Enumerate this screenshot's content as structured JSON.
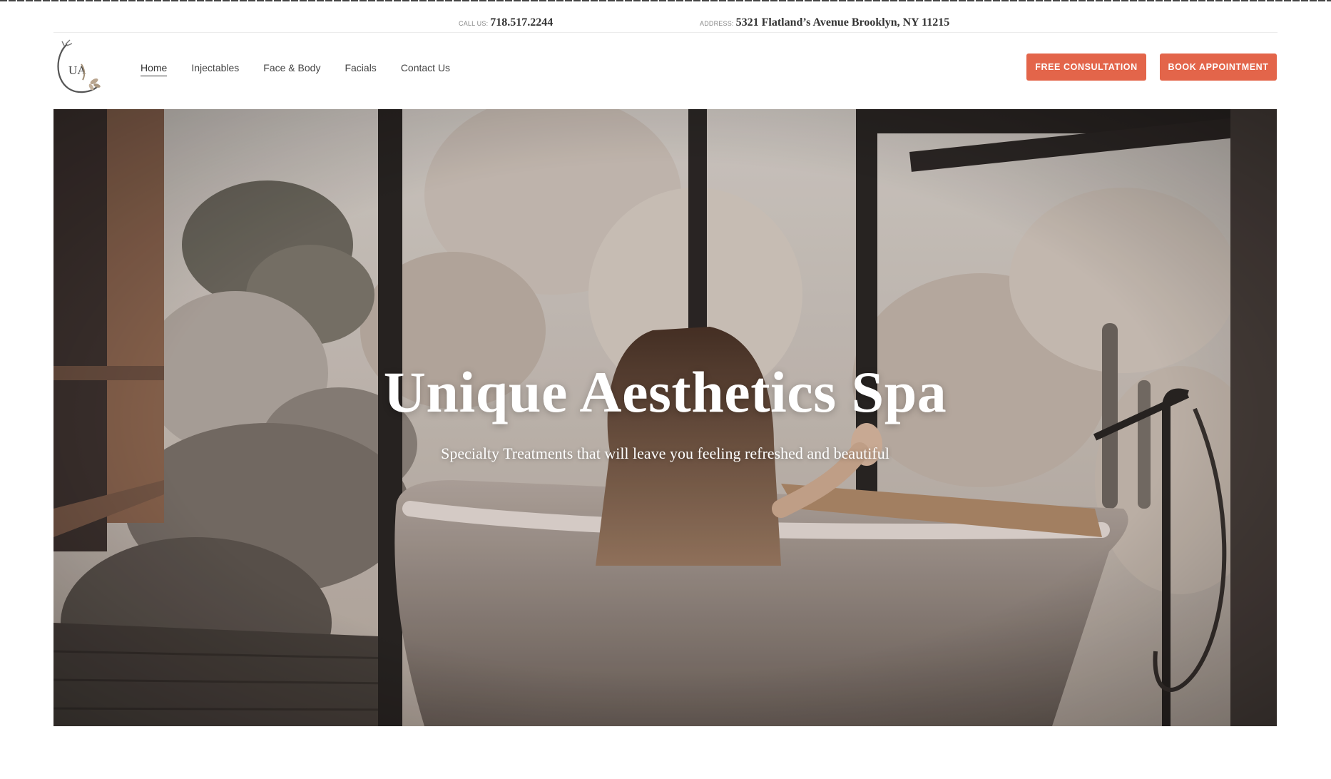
{
  "topbar": {
    "phone_label": "CALL US:",
    "phone": "718.517.2244",
    "address_label": "ADDRESS:",
    "address": "5321 Flatland’s Avenue Brooklyn, NY 11215"
  },
  "logo": {
    "text": "UA"
  },
  "nav": {
    "items": [
      {
        "label": "Home",
        "active": true
      },
      {
        "label": "Injectables"
      },
      {
        "label": "Face & Body"
      },
      {
        "label": "Facials"
      },
      {
        "label": "Contact Us"
      }
    ]
  },
  "buttons": {
    "consultation": "FREE CONSULTATION",
    "book": "BOOK APPOINTMENT"
  },
  "hero": {
    "title": "Unique Aesthetics Spa",
    "subtitle": "Specialty Treatments that will leave you feeling refreshed and beautiful"
  },
  "colors": {
    "accent": "#e3654a",
    "text": "#333333"
  }
}
